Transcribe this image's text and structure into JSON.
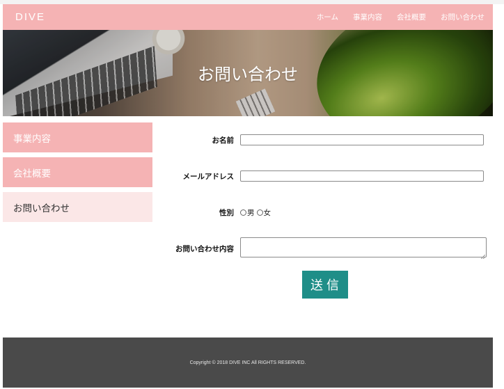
{
  "brand": {
    "logo": "DIVE",
    "accent_color": "#f5b3b4",
    "button_color": "#1f8e88",
    "footer_color": "#4a4a4a"
  },
  "nav": {
    "items": [
      {
        "label": "ホーム"
      },
      {
        "label": "事業内容"
      },
      {
        "label": "会社概要"
      },
      {
        "label": "お問い合わせ"
      }
    ]
  },
  "hero": {
    "title": "お問い合わせ"
  },
  "sidebar": {
    "items": [
      {
        "label": "事業内容",
        "active": false
      },
      {
        "label": "会社概要",
        "active": false
      },
      {
        "label": "お問い合わせ",
        "active": true
      }
    ]
  },
  "form": {
    "name_label": "お名前",
    "name_value": "",
    "email_label": "メールアドレス",
    "email_value": "",
    "gender_label": "性別",
    "gender_options": [
      {
        "label": "男"
      },
      {
        "label": "女"
      }
    ],
    "message_label": "お問い合わせ内容",
    "message_value": "",
    "submit_label": "送信"
  },
  "footer": {
    "copyright": "Copyright © 2018 DIVE INC All RIGHTS RESERVED."
  }
}
